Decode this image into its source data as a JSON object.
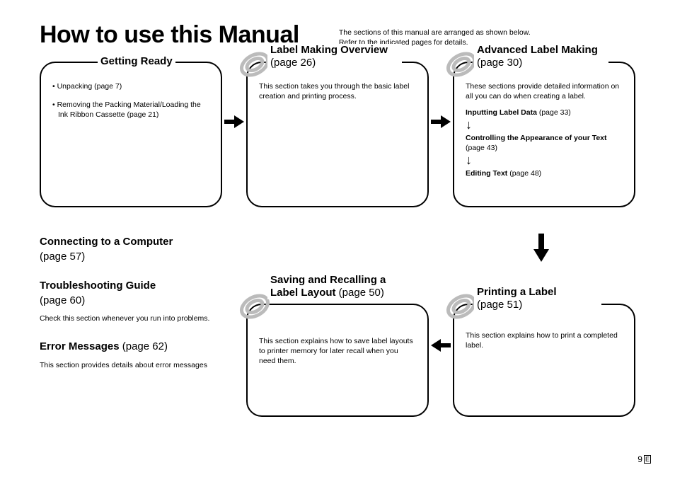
{
  "title": "How to use this Manual",
  "subtitle_line1": "The sections of this manual are arranged as shown below.",
  "subtitle_line2": "Refer to the indicated pages for details.",
  "box1": {
    "title": "Getting Ready",
    "bullet1": "Unpacking (page 7)",
    "bullet2": "Removing the Packing Material/Loading the Ink Ribbon Cassette (page 21)"
  },
  "box2": {
    "title_bold": "Label Making Overview",
    "title_pref": " (page 26)",
    "body": "This section takes you through the basic label creation and printing process."
  },
  "box3": {
    "title_bold": "Advanced Label Making",
    "title_pref": " (page 30)",
    "body": "These sections provide detailed information on all you can do when creating a label.",
    "sub1_bold": "Inputting Label Data",
    "sub1_pref": " (page 33)",
    "sub2_bold": "Controlling the Appearance of your Text",
    "sub2_pref": "(page 43)",
    "sub3_bold": "Editing Text",
    "sub3_pref": " (page 48)"
  },
  "col": {
    "h1_bold": "Connecting to a Computer",
    "h1_pref": "(page 57)",
    "h2_bold": "Troubleshooting Guide",
    "h2_pref": "(page 60)",
    "h2_body": "Check this section whenever you run into problems.",
    "h3_bold": "Error Messages",
    "h3_pref": " (page 62)",
    "h3_body": "This section provides details about error messages"
  },
  "box4": {
    "title_bold": "Saving and Recalling a Label Layout",
    "title_pref": " (page 50)",
    "body": "This section explains how to save label layouts to printer memory for later recall when you need them."
  },
  "box5": {
    "title_bold": "Printing a Label",
    "title_pref": "(page 51)",
    "body": "This section explains how to print a completed label."
  },
  "pagenum": "9",
  "lang": "E"
}
